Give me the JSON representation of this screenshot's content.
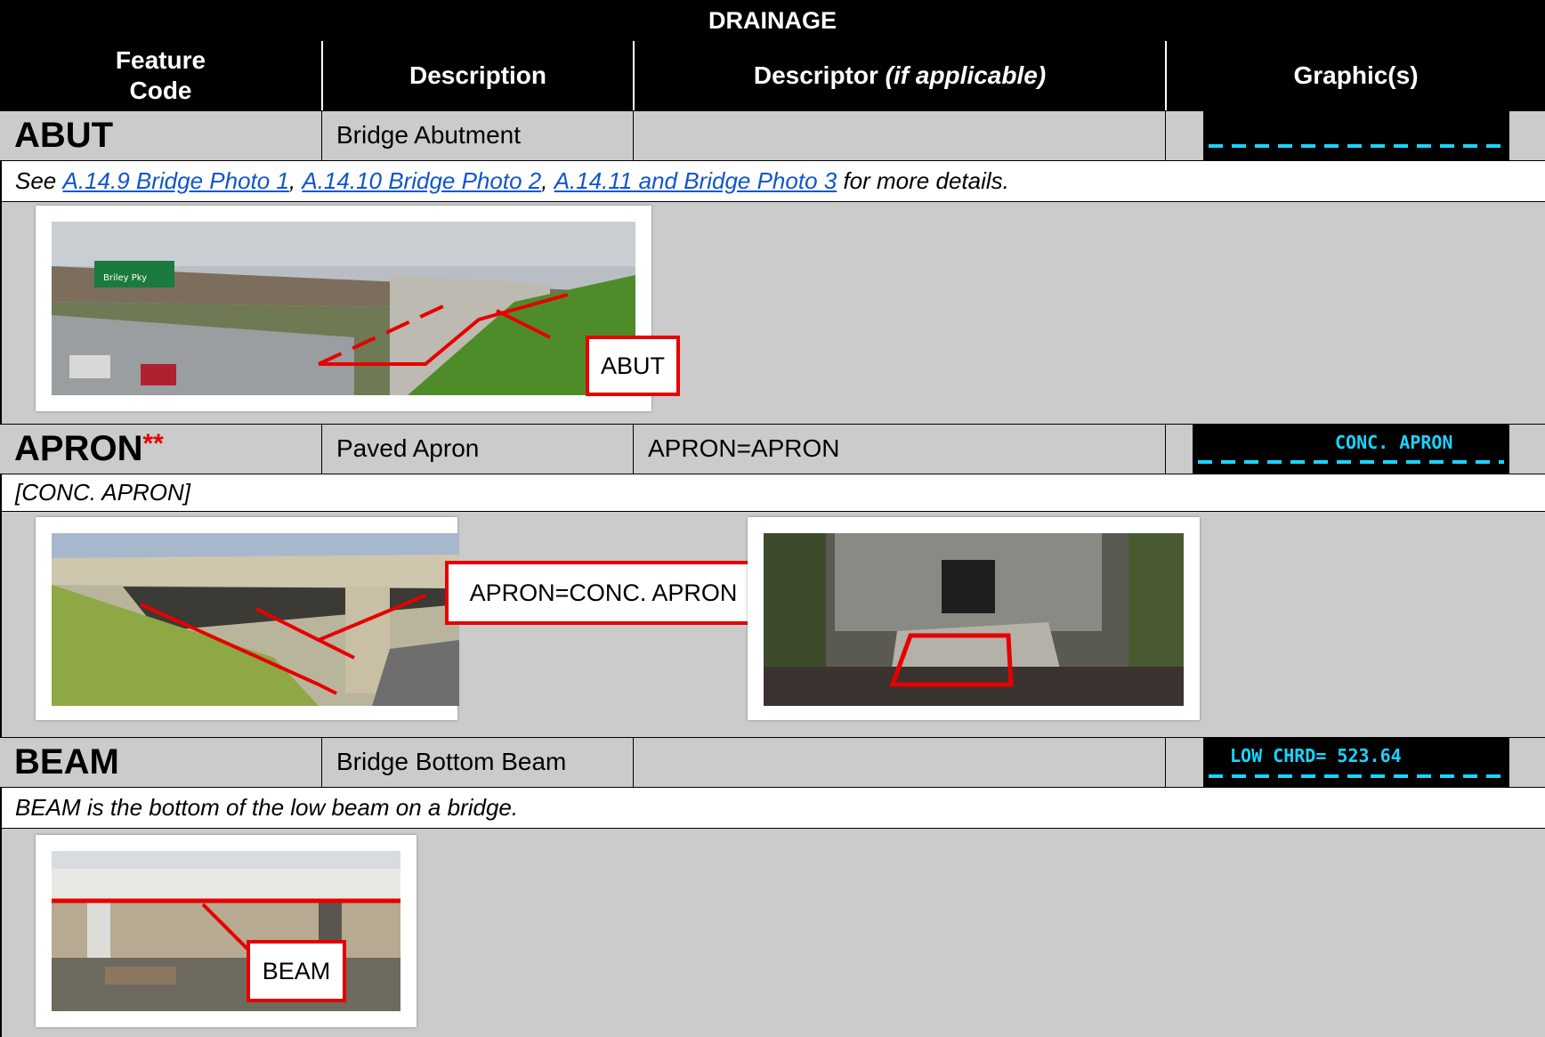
{
  "header": {
    "title": "DRAINAGE",
    "columns": {
      "feature_code": "Feature Code",
      "description": "Description",
      "descriptor": "Descriptor",
      "descriptor_note": "(if applicable)",
      "graphics": "Graphic(s)"
    }
  },
  "rows": {
    "abut": {
      "code": "ABUT",
      "description": "Bridge Abutment",
      "descriptor": "",
      "note": {
        "prefix": "See ",
        "link1": "A.14.9 Bridge Photo 1",
        "sep1": ", ",
        "link2": "A.14.10 Bridge Photo 2",
        "sep2": ", ",
        "link3": "A.14.11 and Bridge Photo 3",
        "suffix": " for more details."
      },
      "callout": "ABUT",
      "sign_text": "Briley Pky"
    },
    "apron": {
      "code": "APRON",
      "code_marker": "**",
      "description": "Paved Apron",
      "descriptor": "APRON=APRON",
      "note": "[CONC. APRON]",
      "callout": "APRON=CONC. APRON",
      "graphic_label": "CONC. APRON"
    },
    "beam": {
      "code": "BEAM",
      "description": "Bridge Bottom Beam",
      "descriptor": "",
      "note": "BEAM is the bottom of the low beam on a bridge.",
      "callout": "BEAM",
      "graphic_label": "LOW CHRD= 523.64"
    }
  },
  "colors": {
    "header_bg": "#000000",
    "row_bg": "#cbcbcb",
    "link": "#1155cc",
    "accent_red": "#e60000",
    "cad_cyan": "#19d4ff"
  }
}
